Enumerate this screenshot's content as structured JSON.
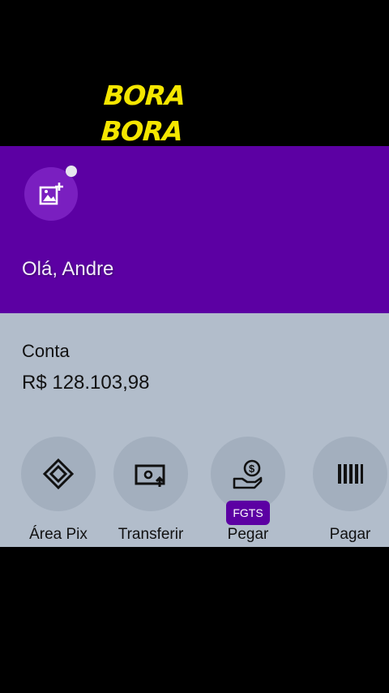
{
  "overlay": {
    "title": "BORA BORA"
  },
  "header": {
    "greeting": "Olá, Andre"
  },
  "account": {
    "label": "Conta",
    "balance": "R$ 128.103,98"
  },
  "actions": [
    {
      "label": "Área Pix",
      "icon": "pix-icon"
    },
    {
      "label": "Transferir",
      "icon": "transfer-icon"
    },
    {
      "label": "Pegar",
      "icon": "loan-icon",
      "badge": "FGTS"
    },
    {
      "label": "Pagar",
      "icon": "barcode-icon"
    }
  ],
  "colors": {
    "brand_purple": "#5c00a3",
    "overlay_yellow": "#f4e600",
    "panel_gray": "#b2bdcb"
  }
}
